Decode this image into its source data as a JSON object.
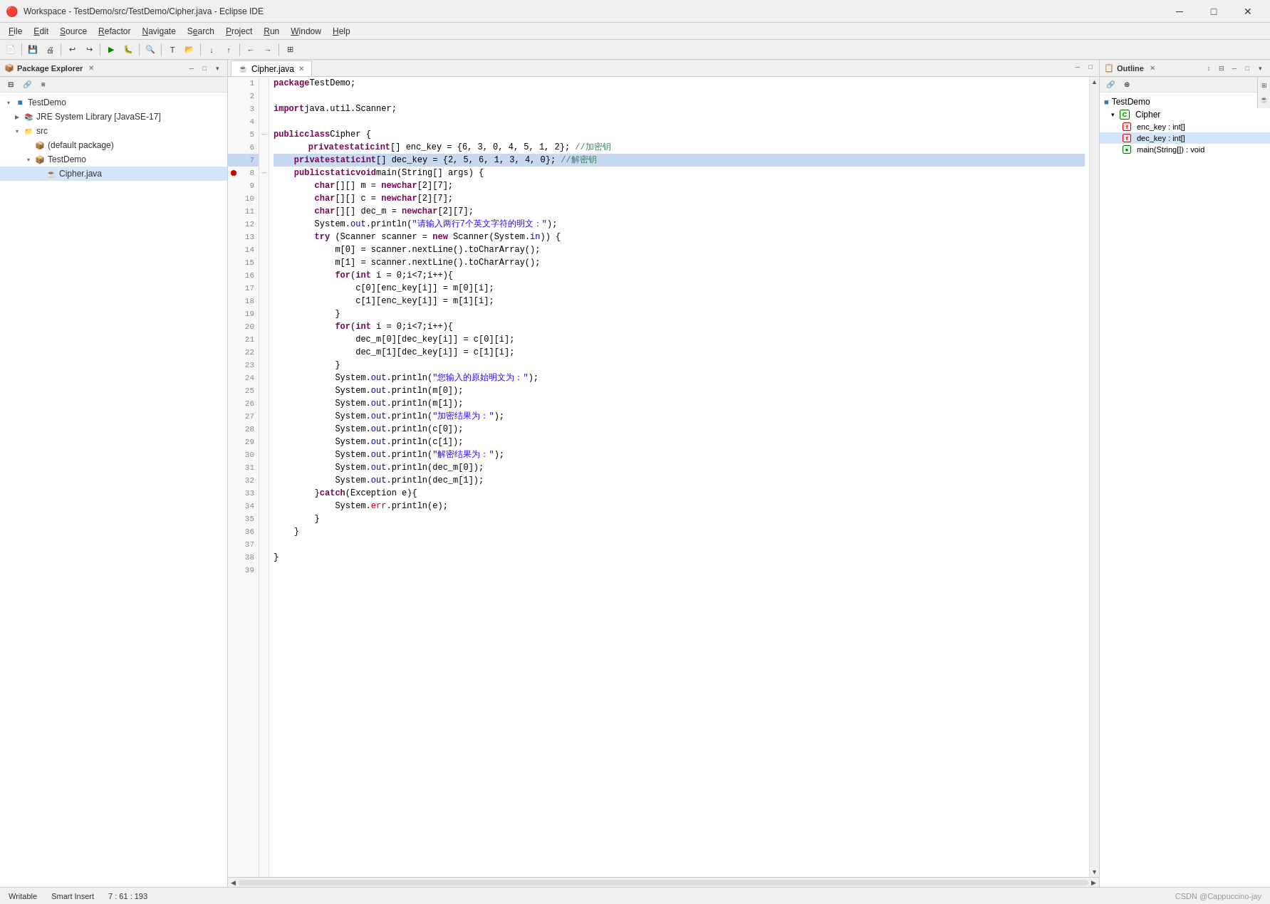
{
  "titleBar": {
    "icon": "eclipse-icon",
    "title": "Workspace - TestDemo/src/TestDemo/Cipher.java - Eclipse IDE",
    "minimize": "─",
    "maximize": "□",
    "close": "✕"
  },
  "menuBar": {
    "items": [
      "File",
      "Edit",
      "Source",
      "Refactor",
      "Navigate",
      "Search",
      "Project",
      "Run",
      "Window",
      "Help"
    ]
  },
  "leftPanel": {
    "title": "Package Explorer",
    "tree": {
      "items": [
        {
          "id": "testdemo-root",
          "label": "TestDemo",
          "level": 0,
          "arrow": "▾",
          "icon": "project"
        },
        {
          "id": "jre",
          "label": "JRE System Library [JavaSE-17]",
          "level": 1,
          "arrow": "▶",
          "icon": "jar"
        },
        {
          "id": "src",
          "label": "src",
          "level": 1,
          "arrow": "▾",
          "icon": "folder"
        },
        {
          "id": "default-pkg",
          "label": "(default package)",
          "level": 2,
          "arrow": "",
          "icon": "package"
        },
        {
          "id": "testdemo-pkg",
          "label": "TestDemo",
          "level": 2,
          "arrow": "▾",
          "icon": "package"
        },
        {
          "id": "cipher-java",
          "label": "Cipher.java",
          "level": 3,
          "arrow": "",
          "icon": "java"
        }
      ]
    }
  },
  "editorTab": {
    "label": "Cipher.java",
    "active": true
  },
  "codeLines": [
    {
      "num": 1,
      "text": "package TestDemo;",
      "highlight": false
    },
    {
      "num": 2,
      "text": "",
      "highlight": false
    },
    {
      "num": 3,
      "text": "import java.util.Scanner;",
      "highlight": false
    },
    {
      "num": 4,
      "text": "",
      "highlight": false
    },
    {
      "num": 5,
      "text": "public class Cipher {",
      "highlight": false
    },
    {
      "num": 6,
      "text": "    private static int[] enc_key = {6, 3, 0, 4, 5, 1, 2}; //加密钥",
      "highlight": false
    },
    {
      "num": 7,
      "text": "    private static int[] dec_key = {2, 5, 6, 1, 3, 4, 0}; //解密钥",
      "highlight": true
    },
    {
      "num": 8,
      "text": "    public static void main(String[] args) {",
      "highlight": false,
      "breakpoint": true
    },
    {
      "num": 9,
      "text": "        char[][] m = new char[2][7];",
      "highlight": false
    },
    {
      "num": 10,
      "text": "        char[][] c = new char[2][7];",
      "highlight": false
    },
    {
      "num": 11,
      "text": "        char[][] dec_m = new char[2][7];",
      "highlight": false
    },
    {
      "num": 12,
      "text": "        System.out.println(\"请输入两行7个英文字符的明文：\");",
      "highlight": false
    },
    {
      "num": 13,
      "text": "        try (Scanner scanner = new Scanner(System.in)) {",
      "highlight": false
    },
    {
      "num": 14,
      "text": "            m[0] = scanner.nextLine().toCharArray();",
      "highlight": false
    },
    {
      "num": 15,
      "text": "            m[1] = scanner.nextLine().toCharArray();",
      "highlight": false
    },
    {
      "num": 16,
      "text": "            for(int i = 0;i<7;i++){",
      "highlight": false
    },
    {
      "num": 17,
      "text": "                c[0][enc_key[i]] = m[0][i];",
      "highlight": false
    },
    {
      "num": 18,
      "text": "                c[1][enc_key[i]] = m[1][i];",
      "highlight": false
    },
    {
      "num": 19,
      "text": "            }",
      "highlight": false
    },
    {
      "num": 20,
      "text": "            for(int i = 0;i<7;i++){",
      "highlight": false
    },
    {
      "num": 21,
      "text": "                dec_m[0][dec_key[i]] = c[0][i];",
      "highlight": false
    },
    {
      "num": 22,
      "text": "                dec_m[1][dec_key[i]] = c[1][i];",
      "highlight": false
    },
    {
      "num": 23,
      "text": "            }",
      "highlight": false
    },
    {
      "num": 24,
      "text": "            System.out.println(\"您输入的原始明文为：\");",
      "highlight": false
    },
    {
      "num": 25,
      "text": "            System.out.println(m[0]);",
      "highlight": false
    },
    {
      "num": 26,
      "text": "            System.out.println(m[1]);",
      "highlight": false
    },
    {
      "num": 27,
      "text": "            System.out.println(\"加密结果为：\");",
      "highlight": false
    },
    {
      "num": 28,
      "text": "            System.out.println(c[0]);",
      "highlight": false
    },
    {
      "num": 29,
      "text": "            System.out.println(c[1]);",
      "highlight": false
    },
    {
      "num": 30,
      "text": "            System.out.println(\"解密结果为：\");",
      "highlight": false
    },
    {
      "num": 31,
      "text": "            System.out.println(dec_m[0]);",
      "highlight": false
    },
    {
      "num": 32,
      "text": "            System.out.println(dec_m[1]);",
      "highlight": false
    },
    {
      "num": 33,
      "text": "        }catch(Exception e){",
      "highlight": false
    },
    {
      "num": 34,
      "text": "            System.err.println(e);",
      "highlight": false
    },
    {
      "num": 35,
      "text": "        }",
      "highlight": false
    },
    {
      "num": 36,
      "text": "    }",
      "highlight": false
    },
    {
      "num": 37,
      "text": "",
      "highlight": false
    },
    {
      "num": 38,
      "text": "}",
      "highlight": false
    },
    {
      "num": 39,
      "text": "",
      "highlight": false
    }
  ],
  "outline": {
    "title": "Outline",
    "root": "TestDemo",
    "items": [
      {
        "label": "Cipher",
        "icon": "C",
        "level": 0,
        "arrow": "▾",
        "color": "#007700"
      },
      {
        "label": "enc_key : int[]",
        "icon": "f",
        "level": 1,
        "arrow": "",
        "color": "#cc0000"
      },
      {
        "label": "dec_key : int[]",
        "icon": "f",
        "level": 1,
        "arrow": "",
        "color": "#cc0000",
        "selected": true
      },
      {
        "label": "main(String[]) : void",
        "icon": "m",
        "level": 1,
        "arrow": "",
        "color": "#007700"
      }
    ]
  },
  "statusBar": {
    "writable": "Writable",
    "insertMode": "Smart Insert",
    "position": "7 : 61 : 193",
    "watermark": "CSDN @Cappuccino-jay"
  }
}
